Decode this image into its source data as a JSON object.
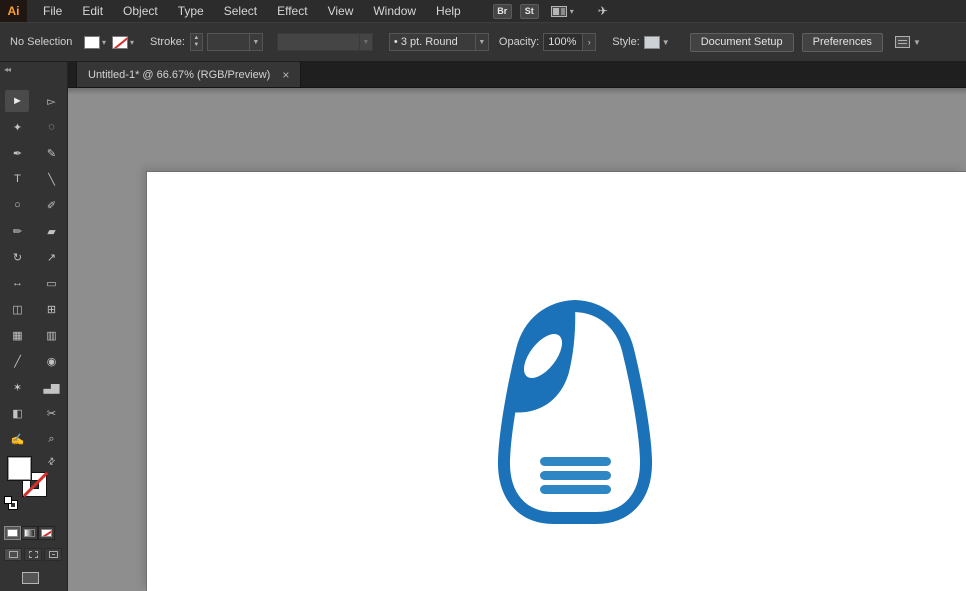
{
  "app": {
    "logo_text": "Ai"
  },
  "menubar": {
    "items": [
      "File",
      "Edit",
      "Object",
      "Type",
      "Select",
      "Effect",
      "View",
      "Window",
      "Help"
    ],
    "bridge_label": "Br",
    "stock_label": "St",
    "caret_glyph": "▾",
    "share_glyph": "✈"
  },
  "controlbar": {
    "selection_status": "No Selection",
    "fill_caret": "▾",
    "stroke_caret": "▾",
    "stroke_label": "Stroke:",
    "stepper_up": "▲",
    "stepper_down": "▼",
    "combo_caret": "▼",
    "brush_dot": "•",
    "brush_name": "3 pt. Round",
    "opacity_label": "Opacity:",
    "opacity_value": "100%",
    "flyout_glyph": "›",
    "style_label": "Style:",
    "document_setup_label": "Document Setup",
    "preferences_label": "Preferences"
  },
  "tabbar": {
    "tab_title": "Untitled-1* @ 66.67% (RGB/Preview)",
    "close_glyph": "×"
  },
  "toolpanel": {
    "collapse_glyph": "◂◂",
    "tools": [
      {
        "name": "selection-tool",
        "glyph": "►",
        "active": true
      },
      {
        "name": "direct-selection-tool",
        "glyph": "▻"
      },
      {
        "name": "magic-wand-tool",
        "glyph": "✦"
      },
      {
        "name": "lasso-tool",
        "glyph": "◌"
      },
      {
        "name": "pen-tool",
        "glyph": "✒"
      },
      {
        "name": "curvature-tool",
        "glyph": "✎"
      },
      {
        "name": "type-tool",
        "glyph": "T"
      },
      {
        "name": "line-segment-tool",
        "glyph": "╲"
      },
      {
        "name": "ellipse-tool",
        "glyph": "○"
      },
      {
        "name": "paintbrush-tool",
        "glyph": "✐"
      },
      {
        "name": "pencil-tool",
        "glyph": "✏"
      },
      {
        "name": "eraser-tool",
        "glyph": "▰"
      },
      {
        "name": "rotate-tool",
        "glyph": "↻"
      },
      {
        "name": "scale-tool",
        "glyph": "↗"
      },
      {
        "name": "width-tool",
        "glyph": "↔"
      },
      {
        "name": "free-transform-tool",
        "glyph": "▭"
      },
      {
        "name": "shape-builder-tool",
        "glyph": "◫"
      },
      {
        "name": "perspective-grid-tool",
        "glyph": "⊞"
      },
      {
        "name": "mesh-tool",
        "glyph": "▦"
      },
      {
        "name": "gradient-tool",
        "glyph": "▥"
      },
      {
        "name": "eyedropper-tool",
        "glyph": "╱"
      },
      {
        "name": "blend-tool",
        "glyph": "◉"
      },
      {
        "name": "symbol-sprayer-tool",
        "glyph": "✶"
      },
      {
        "name": "column-graph-tool",
        "glyph": "▃▆"
      },
      {
        "name": "artboard-tool",
        "glyph": "◧"
      },
      {
        "name": "slice-tool",
        "glyph": "✂"
      },
      {
        "name": "hand-tool",
        "glyph": "✍"
      },
      {
        "name": "zoom-tool",
        "glyph": "⌕"
      }
    ]
  },
  "colors": {
    "accent_blue": "#1b72b8",
    "bars_blue": "#2e86c5",
    "none_red": "#d6302c",
    "logo_orange": "#ff9c33"
  }
}
